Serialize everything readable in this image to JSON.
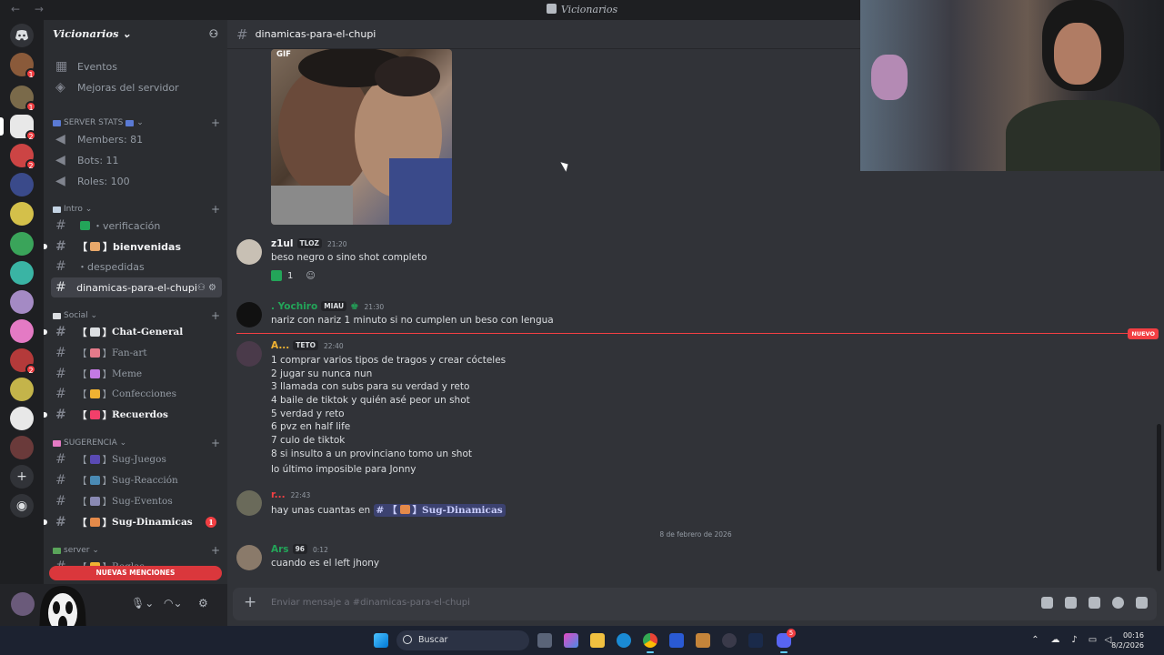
{
  "app": {
    "window_title": "Vicionarios",
    "nav_arrows": "← →"
  },
  "server": {
    "name": "Vicionarios",
    "server_badges": [
      "1",
      "1",
      "2",
      "2",
      "2"
    ]
  },
  "sidebar": {
    "top_items": [
      {
        "label": "Eventos",
        "icon": "calendar-icon"
      },
      {
        "label": "Mejoras del servidor",
        "icon": "boost-icon"
      }
    ],
    "categories": {
      "server_stats": "SERVER STATS",
      "intro": "Intro",
      "social": "Social",
      "sugerencia": "SUGERENCIA",
      "server": "server"
    },
    "stats": [
      "Members: 81",
      "Bots: 11",
      "Roles: 100"
    ],
    "intro_channels": [
      {
        "label": "・verificación"
      },
      {
        "label": "bienvenidas",
        "prefix": "【",
        "suffix": "】"
      },
      {
        "label": "・despedidas"
      },
      {
        "label": "dinamicas-para-el-chupi"
      }
    ],
    "social_channels": [
      {
        "label": "Chat-General",
        "unread": true
      },
      {
        "label": "Fan-art",
        "unread": false
      },
      {
        "label": "Meme",
        "unread": false
      },
      {
        "label": "Confecciones",
        "unread": false
      },
      {
        "label": "Recuerdos",
        "unread": true
      }
    ],
    "sugerencia_channels": [
      {
        "label": "Sug-Juegos"
      },
      {
        "label": "Sug-Reacción"
      },
      {
        "label": "Sug-Eventos"
      },
      {
        "label": "Sug-Dinamicas",
        "mentions": "1"
      }
    ],
    "server_partial": "Reglas",
    "new_mentions": "NUEVAS MENCIONES",
    "bracket_open": "【",
    "bracket_close": "】"
  },
  "channel": {
    "name": "dinamicas-para-el-chupi"
  },
  "messages": {
    "gif_label": "GIF",
    "m1": {
      "author": "z1ul",
      "tag": "TLOZ",
      "time": "21:20",
      "text": "beso negro o sino shot completo",
      "reaction_count": "1",
      "author_color": "#f2f3f5"
    },
    "m2": {
      "author": ". Yochiro",
      "tag": "MIAU",
      "time": "21:30",
      "text": "nariz con nariz 1 minuto si no cumplen un beso con lengua",
      "author_color": "#23a559"
    },
    "m3": {
      "author": "A...",
      "tag": "TETO",
      "time": "22:40",
      "author_color": "#f0b232",
      "lines": [
        "1 comprar varios tipos de tragos y crear cócteles",
        "2 jugar su nunca nun",
        "3 llamada con subs para su verdad y reto",
        "4 baile de tiktok y quién asé peor un shot",
        "5 verdad y reto",
        "6 pvz en half life",
        "7 culo de tiktok",
        "8 si insulto a un provinciano tomo un shot",
        "lo último imposible para Jonny"
      ]
    },
    "m4": {
      "author": "r...",
      "time": "22:43",
      "text": "hay unas cuantas en",
      "mention": "Sug-Dinamicas",
      "mention_hash": "#",
      "author_color": "#f23f43"
    },
    "date_divider": "8 de febrero de 2026",
    "m5": {
      "author": "Ars",
      "tag": "96",
      "time": "0:12",
      "text": "cuando es el left jhony",
      "author_color": "#23a559"
    },
    "new_label": "NUEVO"
  },
  "composer": {
    "placeholder": "Enviar mensaje a #dinamicas-para-el-chupi"
  },
  "taskbar": {
    "search_label": "Buscar",
    "time": "00:16",
    "date": "8/2/2026",
    "discord_badge": "5"
  },
  "colors": {
    "accent": "#5865f2",
    "danger": "#f23f43",
    "online": "#23a559"
  }
}
